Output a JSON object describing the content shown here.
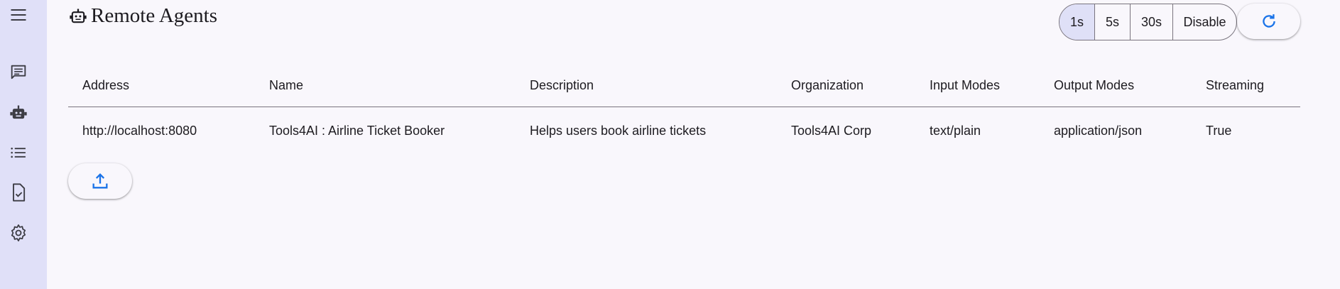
{
  "sidebar": {
    "items": [
      {
        "icon": "menu-icon"
      },
      {
        "icon": "chat-icon"
      },
      {
        "icon": "robot-icon"
      },
      {
        "icon": "list-icon"
      },
      {
        "icon": "task-check-icon"
      },
      {
        "icon": "gear-icon"
      }
    ],
    "background": "#e0e0f8"
  },
  "header": {
    "title": "Remote Agents",
    "title_icon": "robot-icon"
  },
  "refresh_interval": {
    "options": [
      "1s",
      "5s",
      "30s",
      "Disable"
    ],
    "selected": "1s"
  },
  "refresh_button": {
    "icon": "refresh-icon"
  },
  "table": {
    "columns": [
      "Address",
      "Name",
      "Description",
      "Organization",
      "Input Modes",
      "Output Modes",
      "Streaming"
    ],
    "rows": [
      [
        "http://localhost:8080",
        "Tools4AI : Airline Ticket Booker",
        "Helps users book airline tickets",
        "Tools4AI Corp",
        "text/plain",
        "application/json",
        "True"
      ]
    ]
  },
  "upload_button": {
    "icon": "upload-icon"
  },
  "colors": {
    "accent": "#1a73e8",
    "background": "#f9f7fc",
    "selected_segment": "#dfe0f7"
  }
}
